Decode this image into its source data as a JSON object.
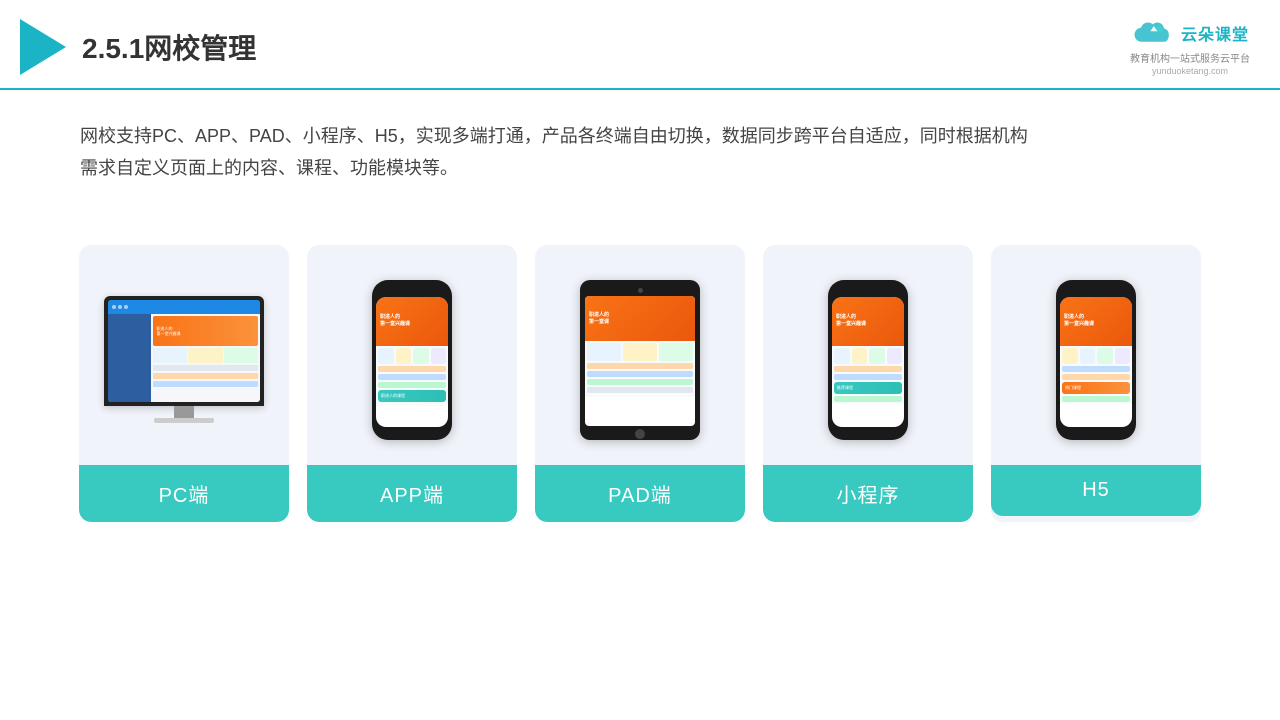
{
  "header": {
    "section_number": "2.5.1",
    "title": "网校管理",
    "brand": {
      "name": "云朵课堂",
      "tagline": "教育机构一站\n式服务云平台",
      "url": "yunduoketang.com"
    }
  },
  "description": {
    "text": "网校支持PC、APP、PAD、小程序、H5，实现多端打通，产品各终端自由切换，数据同步跨平台自适应，同时根据机构",
    "text2": "需求自定义页面上的内容、课程、功能模块等。"
  },
  "cards": [
    {
      "id": "pc",
      "label": "PC端"
    },
    {
      "id": "app",
      "label": "APP端"
    },
    {
      "id": "pad",
      "label": "PAD端"
    },
    {
      "id": "miniprogram",
      "label": "小程序"
    },
    {
      "id": "h5",
      "label": "H5"
    }
  ],
  "colors": {
    "accent": "#38c9c0",
    "header_line": "#1ab4c6",
    "triangle": "#1ab4c6",
    "card_bg": "#f0f4fa",
    "text_main": "#333333",
    "text_desc": "#444444"
  }
}
